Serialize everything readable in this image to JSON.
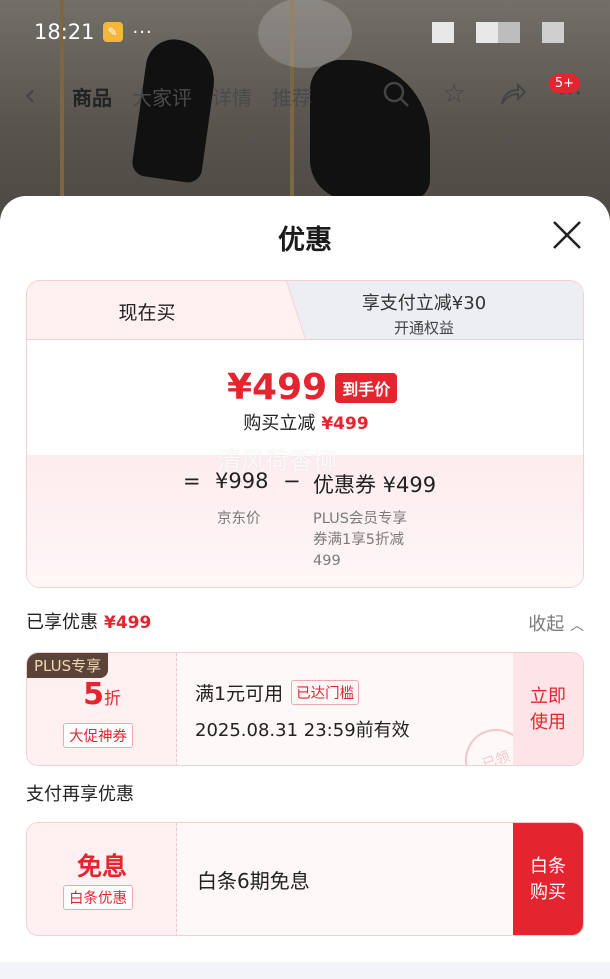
{
  "status_bar": {
    "time": "18:21",
    "more": "···"
  },
  "nav": {
    "tabs": [
      "商品",
      "大家评",
      "详情",
      "推荐"
    ],
    "cart_badge": "5+"
  },
  "sheet": {
    "title": "优惠",
    "price_card": {
      "tab_now": "现在买",
      "tab_pay_line1": "享支付立减¥30",
      "tab_pay_line2": "开通权益",
      "final_price": "¥499",
      "final_price_tag": "到手价",
      "reduce_label": "购买立减",
      "reduce_amount": "¥499",
      "watermark": "清风荷香柳",
      "eq_sign": "=",
      "jd_price": "¥998",
      "minus_sign": "−",
      "coupon_label": "优惠券 ¥499",
      "jd_price_label": "京东价",
      "coupon_desc": [
        "PLUS会员专享",
        "券满1享5折减",
        "499"
      ]
    },
    "enjoyed": {
      "label": "已享优惠",
      "amount": "¥499",
      "collapse_label": "收起"
    },
    "coupon": {
      "plus_tag": "PLUS专享",
      "discount_num": "5",
      "discount_unit": "折",
      "type_tag": "大促神券",
      "condition": "满1元可用",
      "condition_tag": "已达门槛",
      "expiry": "2025.08.31 23:59前有效",
      "action": [
        "立即",
        "使用"
      ],
      "stamp": "已领"
    },
    "pay_section": {
      "heading": "支付再享优惠",
      "big": "免息",
      "tag": "白条优惠",
      "desc": "白条6期免息",
      "action": [
        "白条",
        "购买"
      ]
    }
  },
  "colors": {
    "accent": "#e4252f",
    "card_border": "#f5d0d3",
    "plus_tag_bg": "#5a4437"
  }
}
